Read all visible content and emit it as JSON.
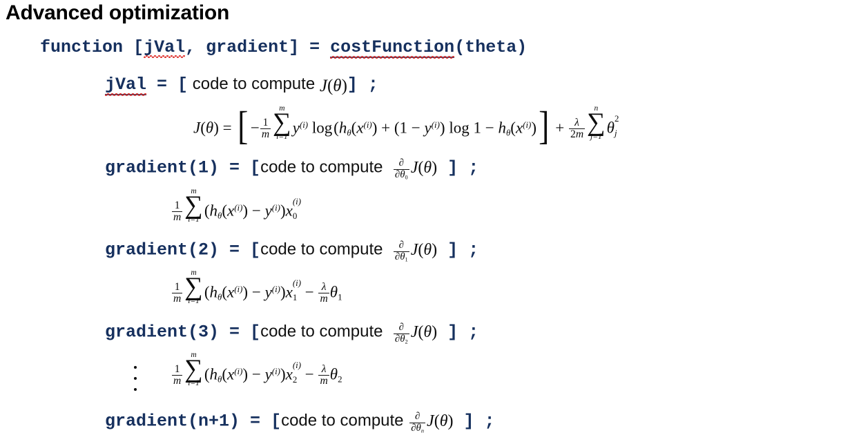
{
  "slide": {
    "title": "Advanced optimization",
    "background_color": "#ffffff",
    "code_color": "#16305e",
    "text_color": "#111111",
    "spellcheck_color": "#e03a36"
  },
  "signature": {
    "keyword": "function",
    "open_bracket": "[",
    "out1": "jVal",
    "comma": ", ",
    "out2": "gradient",
    "close_bracket": "]",
    "equals": " = ",
    "fn_name": "costFunction",
    "args": "(theta)"
  },
  "jval": {
    "name": "jVal",
    "equals": " =  ",
    "open": "[",
    "prose": "code to compute",
    "math": "J(θ)",
    "close": "]",
    "semicolon": " ;"
  },
  "cost_formula": {
    "latex": "J(\\theta) = \\left[-\\frac{1}{m}\\sum_{i=1}^{m} y^{(i)}\\log\\left(h_\\theta(x^{(i)}) + (1-y^{(i)})\\log 1 - h_\\theta(x^{(i)})\\right] + \\frac{\\lambda}{2m}\\sum_{j=1}^{n}\\theta_j^2",
    "plain": "J(theta) = [ -1/m sum_{i=1}^{m} y^(i) log ( h_theta(x^(i)) + (1 - y^(i)) log 1 - h_theta(x^(i)) ] + lambda/(2m) sum_{j=1}^{n} theta_j^2"
  },
  "gradients": [
    {
      "label": "gradient(1)",
      "equals": " = ",
      "open": "[",
      "prose": "code to compute",
      "deriv_sub": "0",
      "close": "]",
      "semicolon": " ;",
      "formula_plain": "1/m sum_{i=1}^{m} (h_theta(x^(i)) - y^(i)) x_0^(i)",
      "has_regularization": false,
      "x_sub": "0",
      "theta_sub": "0"
    },
    {
      "label": "gradient(2)",
      "equals": " = ",
      "open": "[",
      "prose": "code to compute",
      "deriv_sub": "1",
      "close": "]",
      "semicolon": " ;",
      "formula_plain": "1/m sum_{i=1}^{m} (h_theta(x^(i)) - y^(i)) x_1^(i) - (lambda/m) theta_1",
      "has_regularization": true,
      "x_sub": "1",
      "theta_sub": "1"
    },
    {
      "label": "gradient(3)",
      "equals": " = ",
      "open": "[",
      "prose": "code to compute",
      "deriv_sub": "2",
      "close": "]",
      "semicolon": " ;",
      "formula_plain": "1/m sum_{i=1}^{m} (h_theta(x^(i)) - y^(i)) x_2^(i) - (lambda/m) theta_2",
      "has_regularization": true,
      "x_sub": "2",
      "theta_sub": "2"
    }
  ],
  "last_gradient": {
    "label": "gradient(n+1)",
    "equals": " = ",
    "open": "[",
    "prose": "code to compute",
    "deriv_sub": "n",
    "close": "]",
    "semicolon": " ;"
  },
  "symbols": {
    "J": "J",
    "theta": "θ",
    "lambda": "λ",
    "partial": "∂",
    "sigma": "∑",
    "h": "h",
    "x": "x",
    "y": "y",
    "m": "m",
    "n": "n",
    "i": "i",
    "j": "j",
    "one": "1",
    "two": "2",
    "log": "log",
    "minus": "−",
    "plus": "+",
    "eq": "=",
    "lparen": "(",
    "rparen": ")",
    "lbrack": "[",
    "rbrack": "]",
    "vdots": "⋮"
  }
}
